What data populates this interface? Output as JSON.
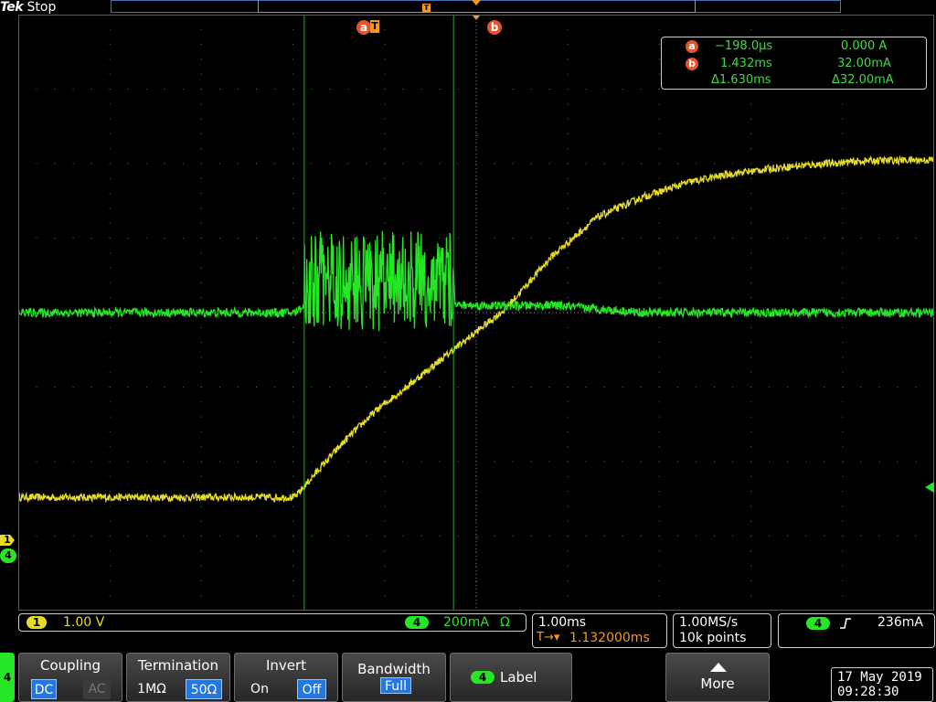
{
  "brand": {
    "logo": "Tek",
    "run_state": "Stop"
  },
  "record_view": {
    "trigger_label": "T"
  },
  "cursors": {
    "a": {
      "label": "a",
      "trigger_label": "T",
      "time_ms": -0.198
    },
    "b": {
      "label": "b",
      "time_ms": 1.432
    }
  },
  "readout": {
    "a": {
      "label": "a",
      "time": "−198.0µs",
      "value": "0.000 A"
    },
    "b": {
      "label": "b",
      "time": "1.432ms",
      "value": "32.00mA"
    },
    "delta": {
      "time": "Δ1.630ms",
      "value": "Δ32.00mA"
    }
  },
  "left_markers": {
    "ch1": "1",
    "ch4": "4"
  },
  "status": {
    "ch1": {
      "badge": "1",
      "scale": "1.00 V"
    },
    "ch4": {
      "badge": "4",
      "scale": "200mA",
      "termination_symbol": "Ω"
    },
    "horizontal": {
      "scale": "1.00ms",
      "trigger_prefix": "T→▾",
      "position": "1.132000ms"
    },
    "acquisition": {
      "sample_rate": "1.00MS/s",
      "record_length": "10k points"
    },
    "trigger": {
      "badge": "4",
      "slope_icon": "rising-edge",
      "level": "236mA"
    }
  },
  "menu": {
    "side_tab": "4",
    "coupling": {
      "title": "Coupling",
      "options": [
        "DC",
        "AC"
      ],
      "selected": "DC"
    },
    "termination": {
      "title": "Termination",
      "options": [
        "1MΩ",
        "50Ω"
      ],
      "selected": "50Ω"
    },
    "invert": {
      "title": "Invert",
      "options": [
        "On",
        "Off"
      ],
      "selected": "Off"
    },
    "bandwidth": {
      "title": "Bandwidth",
      "value": "Full"
    },
    "label": {
      "badge": "4",
      "text": "Label"
    },
    "more": {
      "text": "More"
    }
  },
  "datetime": {
    "date": "17 May 2019",
    "time": "09:28:30"
  },
  "colors": {
    "ch1": "#e6dc28",
    "ch4": "#27e627",
    "cursor_marker": "#e8542a",
    "accent": "#2277e0",
    "record_bar": "#4a6fb5"
  },
  "chart_data": {
    "type": "line",
    "xlabel": "",
    "ylabel": "",
    "x_unit": "ms",
    "x_per_division": 1.0,
    "x_range_ms": [
      -3.32,
      6.68
    ],
    "series": [
      {
        "channel": "1",
        "unit": "V",
        "volts_per_division": 1.0,
        "x": [
          -3.3,
          -1.5,
          -0.3,
          0.0,
          0.3,
          0.6,
          1.0,
          1.43,
          2.0,
          2.5,
          3.0,
          3.5,
          4.0,
          4.5,
          5.0,
          5.5,
          6.0,
          6.7
        ],
        "y": [
          -2.48,
          -2.48,
          -2.48,
          -2.05,
          -1.65,
          -1.3,
          -0.92,
          -0.5,
          0.05,
          0.75,
          1.28,
          1.55,
          1.75,
          1.87,
          1.95,
          2.0,
          2.04,
          2.05
        ]
      },
      {
        "channel": "4",
        "unit": "A",
        "amps_per_division": 0.2,
        "x": [
          -3.3,
          -0.3,
          -0.2,
          -0.15,
          0.0,
          0.3,
          0.7,
          1.0,
          1.3,
          1.43,
          1.45,
          2.0,
          2.5,
          3.0,
          3.5,
          5.0,
          6.7
        ],
        "y": [
          0.0,
          0.0,
          0.02,
          0.12,
          0.14,
          0.11,
          0.1,
          0.1,
          0.12,
          0.13,
          0.02,
          0.018,
          0.02,
          0.01,
          0.0,
          0.0,
          0.0
        ],
        "noise_band_x": [
          -0.2,
          1.43
        ],
        "noise_band_y": [
          -0.05,
          0.22
        ]
      }
    ]
  }
}
